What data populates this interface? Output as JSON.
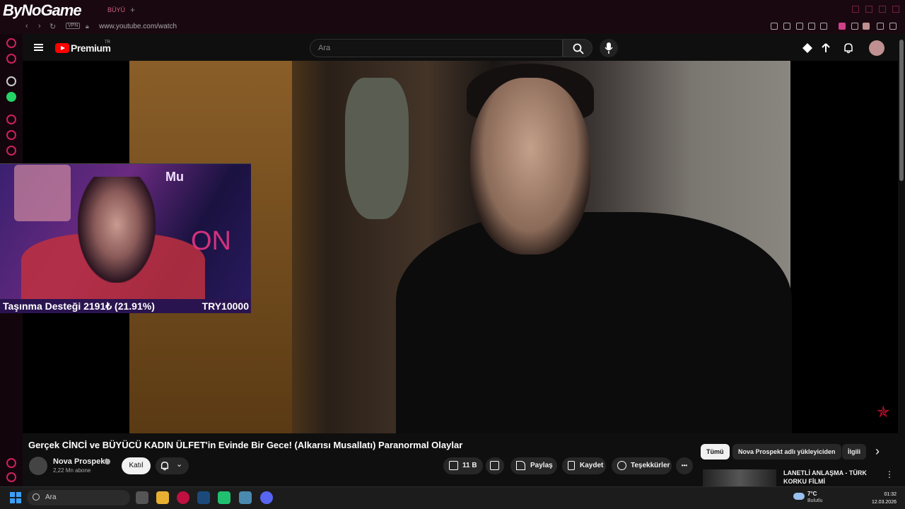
{
  "browser": {
    "logo_text": "ByNoGame",
    "tab_text": "BÜYÜ",
    "new_tab": "+",
    "vpn_label": "VPN",
    "url": "www.youtube.com/watch"
  },
  "youtube": {
    "brand": "Premium",
    "region": "TR",
    "search_placeholder": "Ara"
  },
  "overlay": {
    "streamer_name": "Mu",
    "neon_text": "ON",
    "donation_label": "Taşınma Desteği 2191₺ (21.91%)",
    "donation_goal": "TRY10000",
    "donation_progress": 0.2191
  },
  "video": {
    "title": "Gerçek CİNCİ ve BÜYÜCÜ KADIN ÜLFET'in Evinde Bir Gece! (Alkarısı Musallatı) Paranormal Olaylar",
    "channel": "Nova Prospekt",
    "subscribers": "2,22 Mn abone",
    "join_label": "Katıl",
    "likes": "11 B",
    "share_label": "Paylaş",
    "save_label": "Kaydet",
    "thanks_label": "Teşekkürler",
    "more": "•••"
  },
  "recommendations": {
    "chips": [
      "Tümü",
      "Nova Prospekt adlı yükleyiciden",
      "İlgili"
    ],
    "active_chip": "Tümü",
    "next_arrow": "›",
    "first_title": "LANETLİ ANLAŞMA - TÜRK KORKU FİLMİ",
    "kebab": "⋮"
  },
  "taskbar": {
    "search_placeholder": "Ara",
    "weather_temp": "7°C",
    "weather_desc": "Bulutlu",
    "time": "01:32",
    "date": "12.03.2026"
  },
  "colors": {
    "accent": "#ff0000",
    "browser_bg": "#1a0810",
    "sidebar_accent": "#d0205a"
  }
}
